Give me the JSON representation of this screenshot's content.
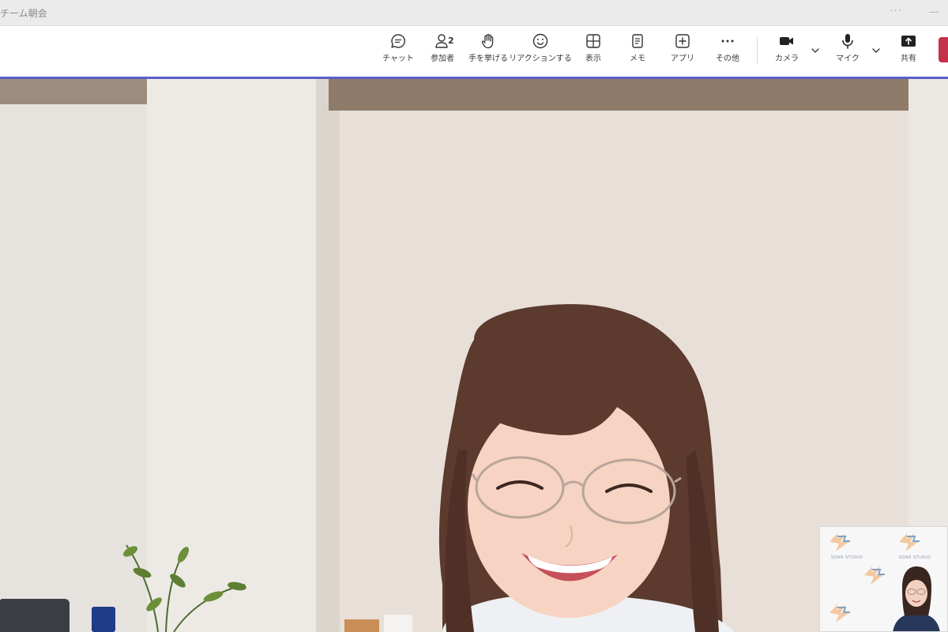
{
  "window": {
    "title": "チーム朝会",
    "more_glyph": "···"
  },
  "toolbar": {
    "buttons": [
      {
        "id": "chat",
        "label": "チャット",
        "icon": "chat-icon"
      },
      {
        "id": "participants",
        "label": "参加者",
        "icon": "participants-icon",
        "count": "2"
      },
      {
        "id": "raise-hand",
        "label": "手を挙げる",
        "icon": "raise-hand-icon"
      },
      {
        "id": "react",
        "label": "リアクションする",
        "icon": "smile-icon"
      },
      {
        "id": "view",
        "label": "表示",
        "icon": "grid-view-icon"
      },
      {
        "id": "notes",
        "label": "メモ",
        "icon": "notes-icon"
      },
      {
        "id": "apps",
        "label": "アプリ",
        "icon": "add-app-icon"
      },
      {
        "id": "more",
        "label": "その他",
        "icon": "more-icon"
      },
      {
        "id": "camera",
        "label": "カメラ",
        "icon": "camera-icon"
      },
      {
        "id": "mic",
        "label": "マイク",
        "icon": "microphone-icon"
      },
      {
        "id": "share",
        "label": "共有",
        "icon": "share-icon"
      }
    ],
    "accent_color": "#5b5fc7",
    "leave_color": "#c4314b"
  },
  "self_view": {
    "logo_caption": "SOAR STUDIO"
  }
}
